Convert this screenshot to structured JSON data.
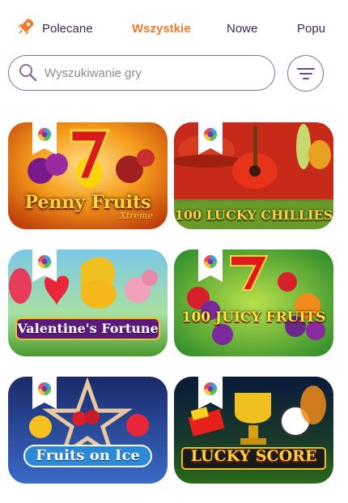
{
  "tabs": [
    {
      "label": "Polecane",
      "active": false,
      "icon": "rocket-icon"
    },
    {
      "label": "Wszystkie",
      "active": true
    },
    {
      "label": "Nowe",
      "active": false
    },
    {
      "label": "Popu",
      "active": false
    }
  ],
  "search": {
    "placeholder": "Wyszukiwanie gry",
    "icon": "search-icon"
  },
  "filter": {
    "icon": "filter-icon"
  },
  "games": [
    {
      "title": "Penny Fruits",
      "subtitle": "Xtreme"
    },
    {
      "title": "100 LUCKY CHILLIES"
    },
    {
      "title": "Valentine's Fortune"
    },
    {
      "title": "100 JUICY FRUITS"
    },
    {
      "title": "Fruits on Ice"
    },
    {
      "title": "LUCKY SCORE"
    }
  ],
  "colors": {
    "accent": "#f07a2a",
    "border": "#8a6aa5",
    "text": "#3a2a52"
  }
}
